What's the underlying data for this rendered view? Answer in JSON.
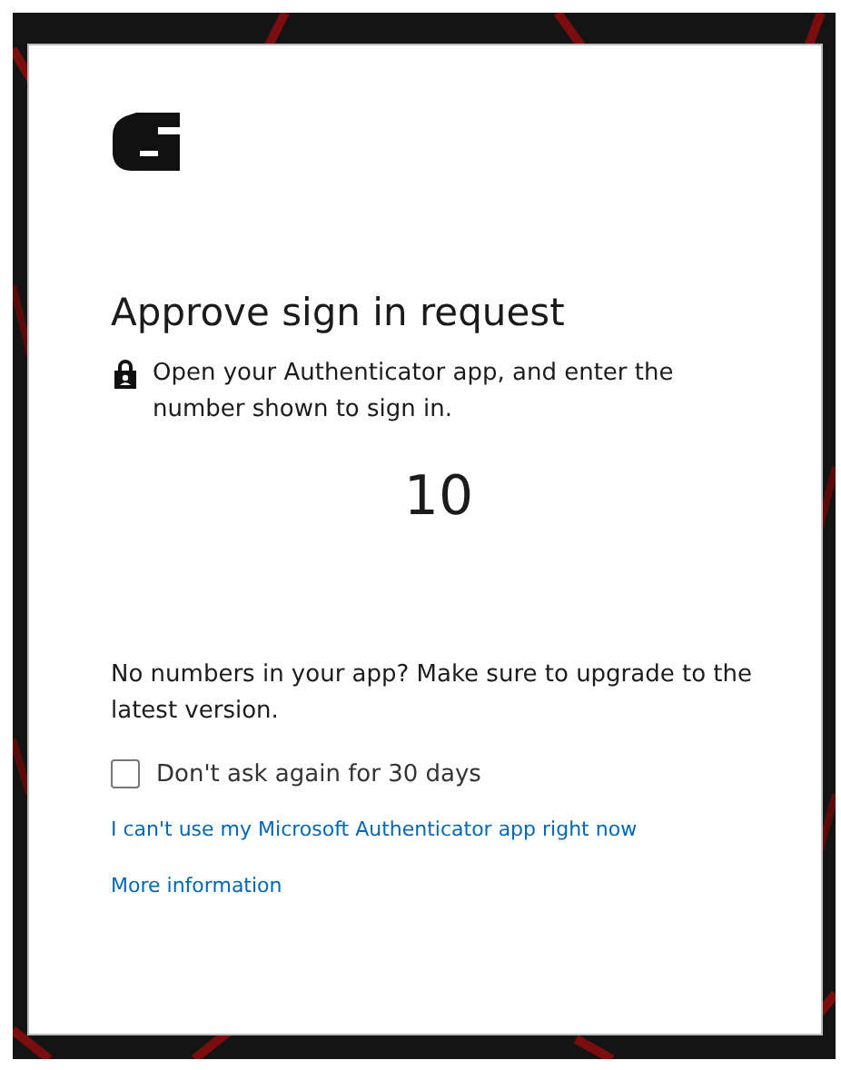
{
  "title": "Approve sign in request",
  "instruction": "Open your Authenticator app, and enter the number shown to sign in.",
  "number": "10",
  "upgrade_note": "No numbers in your app? Make sure to upgrade to the latest version.",
  "remember": {
    "label": "Don't ask again for 30 days",
    "checked": false
  },
  "links": [
    "I can't use my Microsoft Authenticator app right now",
    "More information"
  ]
}
